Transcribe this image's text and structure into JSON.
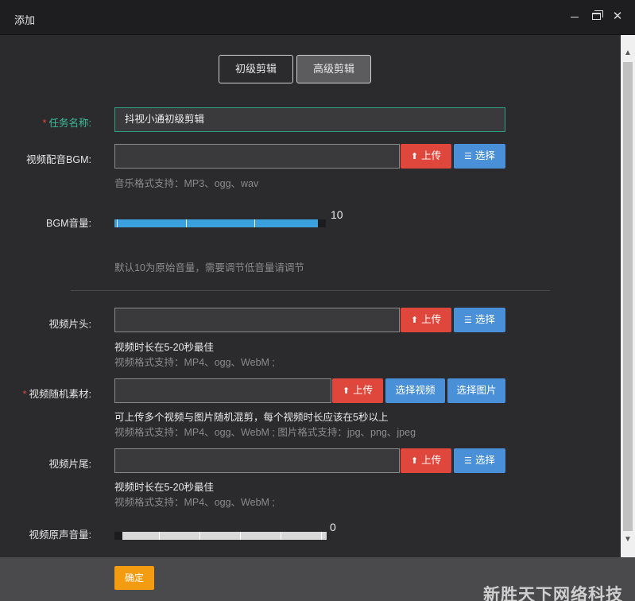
{
  "window": {
    "title": "添加"
  },
  "tabs": [
    {
      "label": "初级剪辑"
    },
    {
      "label": "高级剪辑"
    }
  ],
  "form": {
    "task_name": {
      "label": "任务名称:",
      "value": "抖视小通初级剪辑"
    },
    "bgm": {
      "label": "视频配音BGM:",
      "upload": "上传",
      "select": "选择",
      "hint": "音乐格式支持：MP3、ogg、wav"
    },
    "bgm_volume": {
      "label": "BGM音量:",
      "value": "10",
      "level": 1.0,
      "hint": "默认10为原始音量，需要调节低音量请调节"
    },
    "intro": {
      "label": "视频片头:",
      "upload": "上传",
      "select": "选择",
      "note": "视频时长在5-20秒最佳",
      "hint": "视频格式支持：MP4、ogg、WebM ;"
    },
    "random": {
      "label": "视频随机素材:",
      "upload": "上传",
      "select_video": "选择视频",
      "select_image": "选择图片",
      "note": "可上传多个视频与图片随机混剪，每个视频时长应该在5秒以上",
      "hint": "视频格式支持：MP4、ogg、WebM ; 图片格式支持：jpg、png、jpeg"
    },
    "outro": {
      "label": "视频片尾:",
      "upload": "上传",
      "select": "选择",
      "note": "视频时长在5-20秒最佳",
      "hint": "视频格式支持：MP4、ogg、WebM ;"
    },
    "orig_volume": {
      "label": "视频原声音量:",
      "value": "0",
      "level": 0.0
    }
  },
  "footer": {
    "confirm": "确定",
    "watermark": "新胜天下网络科技"
  },
  "colors": {
    "accent_green": "#3bbd9a",
    "danger": "#e0473c",
    "primary": "#4a90d9",
    "warning": "#f39c12",
    "slider_fill": "#3aa0de"
  }
}
